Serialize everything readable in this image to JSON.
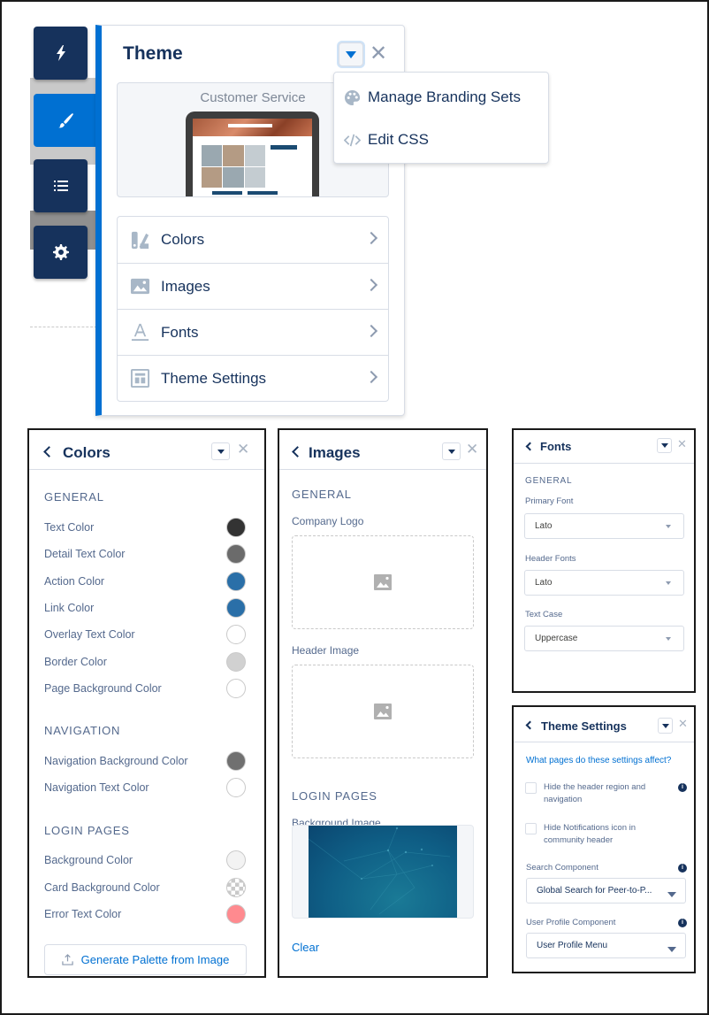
{
  "rail": {
    "items": [
      {
        "name": "lightning",
        "icon": "lightning-icon"
      },
      {
        "name": "theme",
        "icon": "paintbrush-icon",
        "active": true
      },
      {
        "name": "page-structure",
        "icon": "list-icon"
      },
      {
        "name": "settings",
        "icon": "gear-icon"
      }
    ]
  },
  "theme_panel": {
    "title": "Theme",
    "preview_label": "Customer Service",
    "items": [
      {
        "label": "Colors",
        "icon": "color-swatch-icon"
      },
      {
        "label": "Images",
        "icon": "image-icon"
      },
      {
        "label": "Fonts",
        "icon": "font-icon"
      },
      {
        "label": "Theme Settings",
        "icon": "layout-icon"
      }
    ]
  },
  "dropdown": {
    "items": [
      {
        "label": "Manage Branding Sets",
        "icon": "palette-icon"
      },
      {
        "label": "Edit CSS",
        "icon": "code-icon"
      }
    ]
  },
  "colors_panel": {
    "title": "Colors",
    "sections": [
      {
        "heading": "GENERAL",
        "rows": [
          {
            "label": "Text Color",
            "color": "#333333"
          },
          {
            "label": "Detail Text Color",
            "color": "#6b6b6b"
          },
          {
            "label": "Action Color",
            "color": "#2a6fa8"
          },
          {
            "label": "Link Color",
            "color": "#2a6fa8"
          },
          {
            "label": "Overlay Text Color",
            "color": "#ffffff"
          },
          {
            "label": "Border Color",
            "color": "#d1d1d1"
          },
          {
            "label": "Page Background Color",
            "color": "#ffffff"
          }
        ]
      },
      {
        "heading": "NAVIGATION",
        "rows": [
          {
            "label": "Navigation Background Color",
            "color": "#707070"
          },
          {
            "label": "Navigation Text Color",
            "color": "#ffffff"
          }
        ]
      },
      {
        "heading": "LOGIN PAGES",
        "rows": [
          {
            "label": "Background Color",
            "color": "#f3f3f3"
          },
          {
            "label": "Card Background Color",
            "color": "transparent"
          },
          {
            "label": "Error Text Color",
            "color": "#ff8a8f"
          }
        ]
      }
    ],
    "generate_button": "Generate Palette from Image"
  },
  "images_panel": {
    "title": "Images",
    "general_heading": "GENERAL",
    "company_logo_label": "Company Logo",
    "header_image_label": "Header Image",
    "login_heading": "LOGIN PAGES",
    "background_image_label": "Background Image",
    "clear_link": "Clear"
  },
  "fonts_panel": {
    "title": "Fonts",
    "general_heading": "GENERAL",
    "fields": [
      {
        "label": "Primary Font",
        "value": "Lato"
      },
      {
        "label": "Header Fonts",
        "value": "Lato"
      },
      {
        "label": "Text Case",
        "value": "Uppercase"
      }
    ]
  },
  "theme_settings_panel": {
    "title": "Theme Settings",
    "help_link": "What pages do these settings affect?",
    "checkboxes": [
      {
        "label_line1": "Hide the header region and",
        "label_line2": "navigation",
        "checked": false,
        "has_info": true
      },
      {
        "label_line1": "Hide Notifications icon in",
        "label_line2": "community header",
        "checked": false,
        "has_info": false
      }
    ],
    "search_component": {
      "label": "Search Component",
      "value": "Global Search for Peer-to-P..."
    },
    "user_profile_component": {
      "label": "User Profile Component",
      "value": "User Profile Menu"
    }
  }
}
